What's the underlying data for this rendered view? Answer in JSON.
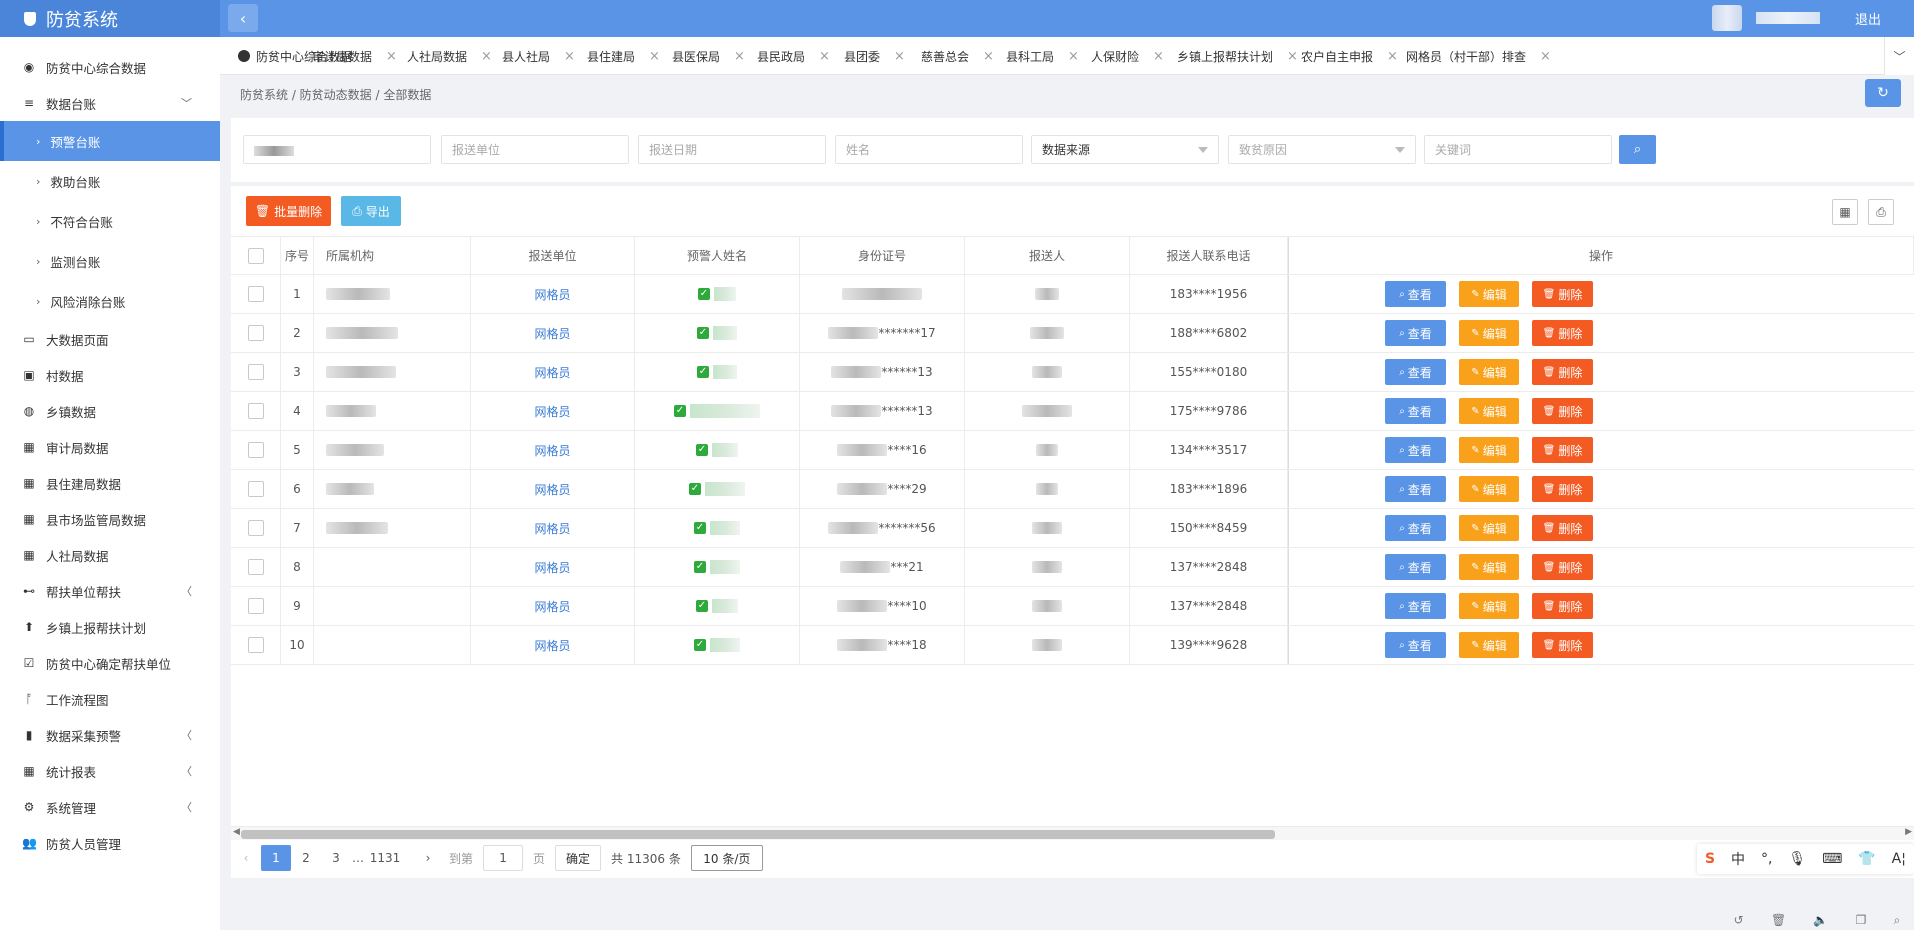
{
  "app": {
    "title": "防贫系统",
    "logout": "退出"
  },
  "sidebar": {
    "items": [
      {
        "label": "防贫中心综合数据",
        "icon": "eye-icon",
        "glyph": "◉"
      },
      {
        "label": "数据台账",
        "icon": "list-icon",
        "glyph": "≡",
        "arrow": "﹀"
      },
      {
        "label": "预警台账",
        "sub": true,
        "active": true
      },
      {
        "label": "救助台账",
        "sub": true
      },
      {
        "label": "不符合台账",
        "sub": true
      },
      {
        "label": "监测台账",
        "sub": true
      },
      {
        "label": "风险消除台账",
        "sub": true
      },
      {
        "label": "大数据页面",
        "icon": "monitor-icon",
        "glyph": "▭"
      },
      {
        "label": "村数据",
        "icon": "calendar-check-icon",
        "glyph": "▣"
      },
      {
        "label": "乡镇数据",
        "icon": "compass-icon",
        "glyph": "◍"
      },
      {
        "label": "审计局数据",
        "icon": "calculator-icon",
        "glyph": "▦"
      },
      {
        "label": "县住建局数据",
        "icon": "calculator-icon",
        "glyph": "▦"
      },
      {
        "label": "县市场监管局数据",
        "icon": "calculator-icon",
        "glyph": "▦"
      },
      {
        "label": "人社局数据",
        "icon": "calculator-icon",
        "glyph": "▦"
      },
      {
        "label": "帮扶单位帮扶",
        "icon": "handshake-icon",
        "glyph": "⊷",
        "arrow": "〈"
      },
      {
        "label": "乡镇上报帮扶计划",
        "icon": "upload-circle-icon",
        "glyph": "⬆"
      },
      {
        "label": "防贫中心确定帮扶单位",
        "icon": "checkbox-icon",
        "glyph": "☑"
      },
      {
        "label": "工作流程图",
        "icon": "flow-icon",
        "glyph": "ᚩ"
      },
      {
        "label": "数据采集预警",
        "icon": "bookmark-icon",
        "glyph": "▮",
        "arrow": "〈"
      },
      {
        "label": "统计报表",
        "icon": "calculator-icon",
        "glyph": "▦",
        "arrow": "〈"
      },
      {
        "label": "系统管理",
        "icon": "gears-icon",
        "glyph": "⚙",
        "arrow": "〈"
      },
      {
        "label": "防贫人员管理",
        "icon": "users-icon",
        "glyph": "👥"
      }
    ]
  },
  "tabs": [
    {
      "label": "防贫中心综合数据",
      "closable": false,
      "icon": true
    },
    {
      "label": "审计局数据",
      "closable": true
    },
    {
      "label": "人社局数据",
      "closable": true
    },
    {
      "label": "县人社局",
      "closable": true
    },
    {
      "label": "县住建局",
      "closable": true
    },
    {
      "label": "县医保局",
      "closable": true
    },
    {
      "label": "县民政局",
      "closable": true
    },
    {
      "label": "县团委",
      "closable": true
    },
    {
      "label": "慈善总会",
      "closable": true
    },
    {
      "label": "县科工局",
      "closable": true
    },
    {
      "label": "人保财险",
      "closable": true
    },
    {
      "label": "乡镇上报帮扶计划",
      "closable": true
    },
    {
      "label": "农户自主申报",
      "closable": true
    },
    {
      "label": "网格员（村干部）排查",
      "closable": true
    }
  ],
  "breadcrumb": "防贫系统 / 防贫动态数据 / 全部数据",
  "filters": {
    "unit_placeholder": "报送单位",
    "date_placeholder": "报送日期",
    "name_placeholder": "姓名",
    "source_value": "数据来源",
    "cause_placeholder": "致贫原因",
    "keyword_placeholder": "关键词"
  },
  "toolbar": {
    "batch_delete": "批量删除",
    "export": "导出"
  },
  "table": {
    "headers": [
      "序号",
      "所属机构",
      "报送单位",
      "预警人姓名",
      "身份证号",
      "报送人",
      "报送人联系电话",
      "操作"
    ],
    "rows": [
      {
        "no": "1",
        "unit": "网格员",
        "id_suffix": "",
        "phone": "183****1956"
      },
      {
        "no": "2",
        "unit": "网格员",
        "id_suffix": "*******17",
        "phone": "188****6802"
      },
      {
        "no": "3",
        "unit": "网格员",
        "id_suffix": "******13",
        "phone": "155****0180"
      },
      {
        "no": "4",
        "unit": "网格员",
        "id_suffix": "******13",
        "phone": "175****9786"
      },
      {
        "no": "5",
        "unit": "网格员",
        "id_suffix": "****16",
        "phone": "134****3517"
      },
      {
        "no": "6",
        "unit": "网格员",
        "id_suffix": "****29",
        "phone": "183****1896"
      },
      {
        "no": "7",
        "unit": "网格员",
        "id_suffix": "*******56",
        "phone": "150****8459"
      },
      {
        "no": "8",
        "unit": "网格员",
        "id_suffix": "***21",
        "phone": "137****2848"
      },
      {
        "no": "9",
        "unit": "网格员",
        "id_suffix": "****10",
        "phone": "137****2848"
      },
      {
        "no": "10",
        "unit": "网格员",
        "id_suffix": "****18",
        "phone": "139****9628"
      }
    ],
    "actions": {
      "view": "查看",
      "edit": "编辑",
      "delete": "删除"
    }
  },
  "pagination": {
    "pages": [
      "1",
      "2",
      "3",
      "…",
      "1131"
    ],
    "goto_label": "到第",
    "page_input": "1",
    "page_suffix": "页",
    "confirm": "确定",
    "total": "共 11306 条",
    "page_size": "10 条/页"
  },
  "ime": [
    "中",
    "°,",
    "🎙",
    "⌨",
    "👕",
    "A¦"
  ],
  "colors": {
    "primary": "#5a94e6",
    "danger": "#f35b23",
    "warning": "#f9a11b",
    "info": "#5ab8e6"
  }
}
